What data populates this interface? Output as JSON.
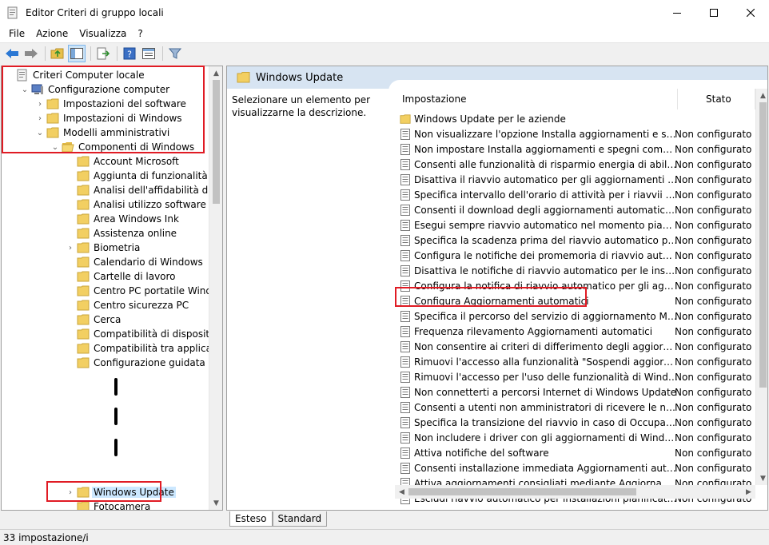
{
  "window": {
    "title": "Editor Criteri di gruppo locali"
  },
  "menu": [
    "File",
    "Azione",
    "Visualizza",
    "?"
  ],
  "tree": {
    "items": [
      {
        "label": "Criteri Computer locale",
        "level": 0,
        "icon": "policy-doc-icon",
        "expander": ""
      },
      {
        "label": "Configurazione computer",
        "level": 1,
        "icon": "computer-icon",
        "expander": "expanded"
      },
      {
        "label": "Impostazioni del software",
        "level": 2,
        "icon": "folder-icon",
        "expander": "collapsed"
      },
      {
        "label": "Impostazioni di Windows",
        "level": 2,
        "icon": "folder-icon",
        "expander": "collapsed"
      },
      {
        "label": "Modelli amministrativi",
        "level": 2,
        "icon": "folder-icon",
        "expander": "expanded"
      },
      {
        "label": "Componenti di Windows",
        "level": 3,
        "icon": "folder-open-icon",
        "expander": "expanded"
      },
      {
        "label": "Account Microsoft",
        "level": 4,
        "icon": "folder-icon",
        "expander": ""
      },
      {
        "label": "Aggiunta di funzionalità a Windows",
        "level": 4,
        "icon": "folder-icon",
        "expander": ""
      },
      {
        "label": "Analisi dell'affidabilità di Windows",
        "level": 4,
        "icon": "folder-icon",
        "expander": ""
      },
      {
        "label": "Analisi utilizzo software Windows",
        "level": 4,
        "icon": "folder-icon",
        "expander": ""
      },
      {
        "label": "Area Windows Ink",
        "level": 4,
        "icon": "folder-icon",
        "expander": ""
      },
      {
        "label": "Assistenza online",
        "level": 4,
        "icon": "folder-icon",
        "expander": ""
      },
      {
        "label": "Biometria",
        "level": 4,
        "icon": "folder-icon",
        "expander": "collapsed"
      },
      {
        "label": "Calendario di Windows",
        "level": 4,
        "icon": "folder-icon",
        "expander": ""
      },
      {
        "label": "Cartelle di lavoro",
        "level": 4,
        "icon": "folder-icon",
        "expander": ""
      },
      {
        "label": "Centro PC portatile Windows",
        "level": 4,
        "icon": "folder-icon",
        "expander": ""
      },
      {
        "label": "Centro sicurezza PC",
        "level": 4,
        "icon": "folder-icon",
        "expander": ""
      },
      {
        "label": "Cerca",
        "level": 4,
        "icon": "folder-icon",
        "expander": ""
      },
      {
        "label": "Compatibilità di dispositivi e driver",
        "level": 4,
        "icon": "folder-icon",
        "expander": ""
      },
      {
        "label": "Compatibilità tra applicazioni",
        "level": 4,
        "icon": "folder-icon",
        "expander": ""
      },
      {
        "label": "Configurazione guidata",
        "level": 4,
        "icon": "folder-icon",
        "expander": ""
      }
    ],
    "bottom_items": [
      {
        "label": "Windows Update",
        "level": 4,
        "icon": "folder-icon",
        "expander": "collapsed",
        "selected": true
      },
      {
        "label": "Fotocamera",
        "level": 4,
        "icon": "folder-icon",
        "expander": ""
      }
    ]
  },
  "right": {
    "header_title": "Windows Update",
    "description": "Selezionare un elemento per visualizzarne la descrizione.",
    "columns": {
      "setting": "Impostazione",
      "state": "Stato"
    },
    "rows": [
      {
        "name": "Windows Update per le aziende",
        "state": "",
        "icon": "folder-icon"
      },
      {
        "name": "Non visualizzare l'opzione Installa aggiornamenti e spegni nella finestra di dialogo Arresta Windows",
        "state": "Non configurato",
        "icon": "setting-icon"
      },
      {
        "name": "Non impostare Installa aggiornamenti e spegni come opzione predefinita",
        "state": "Non configurato",
        "icon": "setting-icon"
      },
      {
        "name": "Consenti alle funzionalità di risparmio energia di abilitare automaticamente",
        "state": "Non configurato",
        "icon": "setting-icon"
      },
      {
        "name": "Disattiva il riavvio automatico per gli aggiornamenti durante l'orario di attività",
        "state": "Non configurato",
        "icon": "setting-icon"
      },
      {
        "name": "Specifica intervallo dell'orario di attività per i riavvii automatici",
        "state": "Non configurato",
        "icon": "setting-icon"
      },
      {
        "name": "Consenti il download degli aggiornamenti automaticamente",
        "state": "Non configurato",
        "icon": "setting-icon"
      },
      {
        "name": "Esegui sempre riavvio automatico nel momento pianificato",
        "state": "Non configurato",
        "icon": "setting-icon"
      },
      {
        "name": "Specifica la scadenza prima del riavvio automatico per l'installazione",
        "state": "Non configurato",
        "icon": "setting-icon"
      },
      {
        "name": "Configura le notifiche dei promemoria di riavvio automatico",
        "state": "Non configurato",
        "icon": "setting-icon"
      },
      {
        "name": "Disattiva le notifiche di riavvio automatico per le installazioni",
        "state": "Non configurato",
        "icon": "setting-icon"
      },
      {
        "name": "Configura la notifica di riavvio automatico per gli aggiornamenti",
        "state": "Non configurato",
        "icon": "setting-icon"
      },
      {
        "name": "Configura Aggiornamenti automatici",
        "state": "Non configurato",
        "icon": "setting-icon"
      },
      {
        "name": "Specifica il percorso del servizio di aggiornamento Microsoft",
        "state": "Non configurato",
        "icon": "setting-icon"
      },
      {
        "name": "Frequenza rilevamento Aggiornamenti automatici",
        "state": "Non configurato",
        "icon": "setting-icon"
      },
      {
        "name": "Non consentire ai criteri di differimento degli aggiornamenti",
        "state": "Non configurato",
        "icon": "setting-icon"
      },
      {
        "name": "Rimuovi l'accesso alla funzionalità \"Sospendi aggiornamenti\"",
        "state": "Non configurato",
        "icon": "setting-icon"
      },
      {
        "name": "Rimuovi l'accesso per l'uso delle funzionalità di Windows Update",
        "state": "Non configurato",
        "icon": "setting-icon"
      },
      {
        "name": "Non connetterti a percorsi Internet di Windows Update",
        "state": "Non configurato",
        "icon": "setting-icon"
      },
      {
        "name": "Consenti a utenti non amministratori di ricevere le notifiche di aggiornamento",
        "state": "Non configurato",
        "icon": "setting-icon"
      },
      {
        "name": "Specifica la transizione del riavvio in caso di Occupato e la pianificazione",
        "state": "Non configurato",
        "icon": "setting-icon"
      },
      {
        "name": "Non includere i driver con gli aggiornamenti di Windows",
        "state": "Non configurato",
        "icon": "setting-icon"
      },
      {
        "name": "Attiva notifiche del software",
        "state": "Non configurato",
        "icon": "setting-icon"
      },
      {
        "name": "Consenti installazione immediata Aggiornamenti automatici",
        "state": "Non configurato",
        "icon": "setting-icon"
      },
      {
        "name": "Attiva aggiornamenti consigliati mediante Aggiornamenti automatici",
        "state": "Non configurato",
        "icon": "setting-icon"
      },
      {
        "name": "Escludi riavvio automatico per installazioni pianificate di Aggiornamenti automatici",
        "state": "Non configurato",
        "icon": "setting-icon"
      }
    ]
  },
  "tabs": [
    "Esteso",
    "Standard"
  ],
  "status": "33 impostazione/i"
}
